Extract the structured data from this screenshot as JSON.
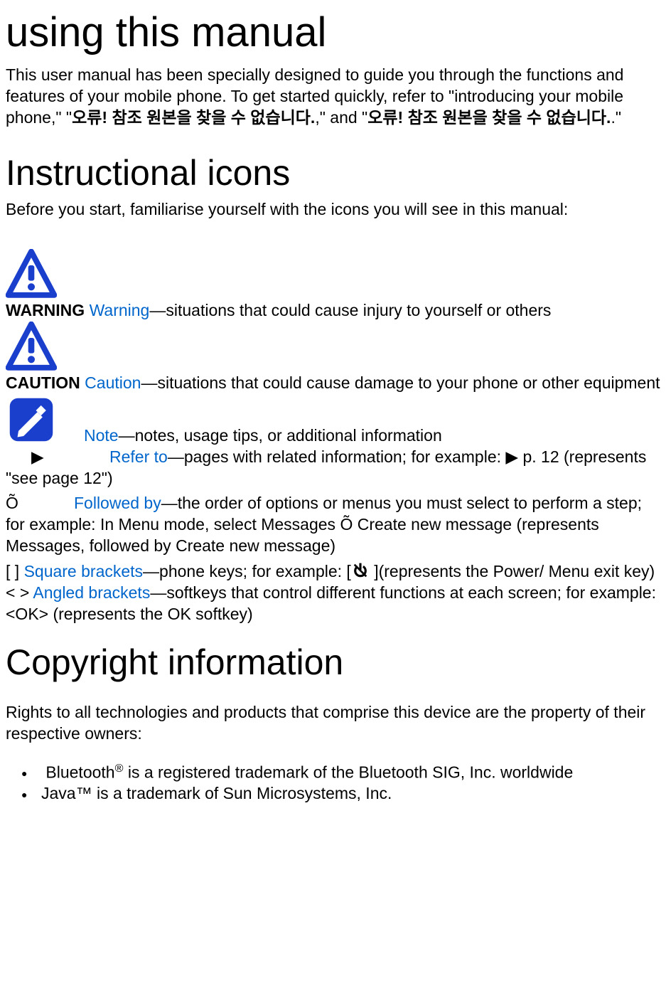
{
  "title": "using this manual",
  "intro_parts": {
    "a": "This user manual has been specially designed to guide you through the functions and features of your mobile phone. To get started quickly, refer to \"introducing your mobile phone,\" \"",
    "b": "오류!  참조  원본을  찾을  수  없습니다.",
    "c": ",\" and \"",
    "d": "오류!  참조  원본을  찾을  수  없습니다.",
    "e": ".\""
  },
  "icons_section": {
    "title": "Instructional icons",
    "intro": "Before you start, familiarise yourself with the icons you will see in this manual:"
  },
  "icon_rows": {
    "warning": {
      "label": "WARNING",
      "term": "Warning",
      "desc": "—situations that could cause injury to yourself or others"
    },
    "caution": {
      "label": "CAUTION",
      "term": "Caution",
      "desc": "—situations that could cause damage to your phone or other equipment"
    },
    "note": {
      "term": "Note",
      "desc": "—notes, usage tips, or additional information"
    },
    "refer": {
      "symbol": "▶",
      "term": "Refer to",
      "desc": "—pages with related information; for example: ▶ p. 12 (represents \"see page 12\")"
    },
    "followed": {
      "symbol": "Õ",
      "term": "Followed by",
      "desc": "—the order of options or menus you must select to perform a step; for example: In Menu mode, select Messages Õ Create new message (represents Messages, followed by Create new message)"
    },
    "square": {
      "symbol": "[    ]",
      "term": "Square brackets",
      "desc_a": "—phone keys; for example: [",
      "desc_b": " ](represents the Power/ Menu exit key)"
    },
    "angled": {
      "symbol": "<    >",
      "term": "Angled brackets",
      "desc": "—softkeys that control different functions at each screen; for example: <OK> (represents the OK softkey)"
    }
  },
  "copyright": {
    "title": "Copyright information",
    "intro": "Rights to all technologies and products that comprise this device are the property of their respective owners:",
    "items": {
      "bt_a": "Bluetooth",
      "bt_sup": "®",
      "bt_b": " is a registered trademark of the Bluetooth SIG, Inc. worldwide",
      "java": "Java™ is a trademark of Sun Microsystems, Inc."
    }
  }
}
